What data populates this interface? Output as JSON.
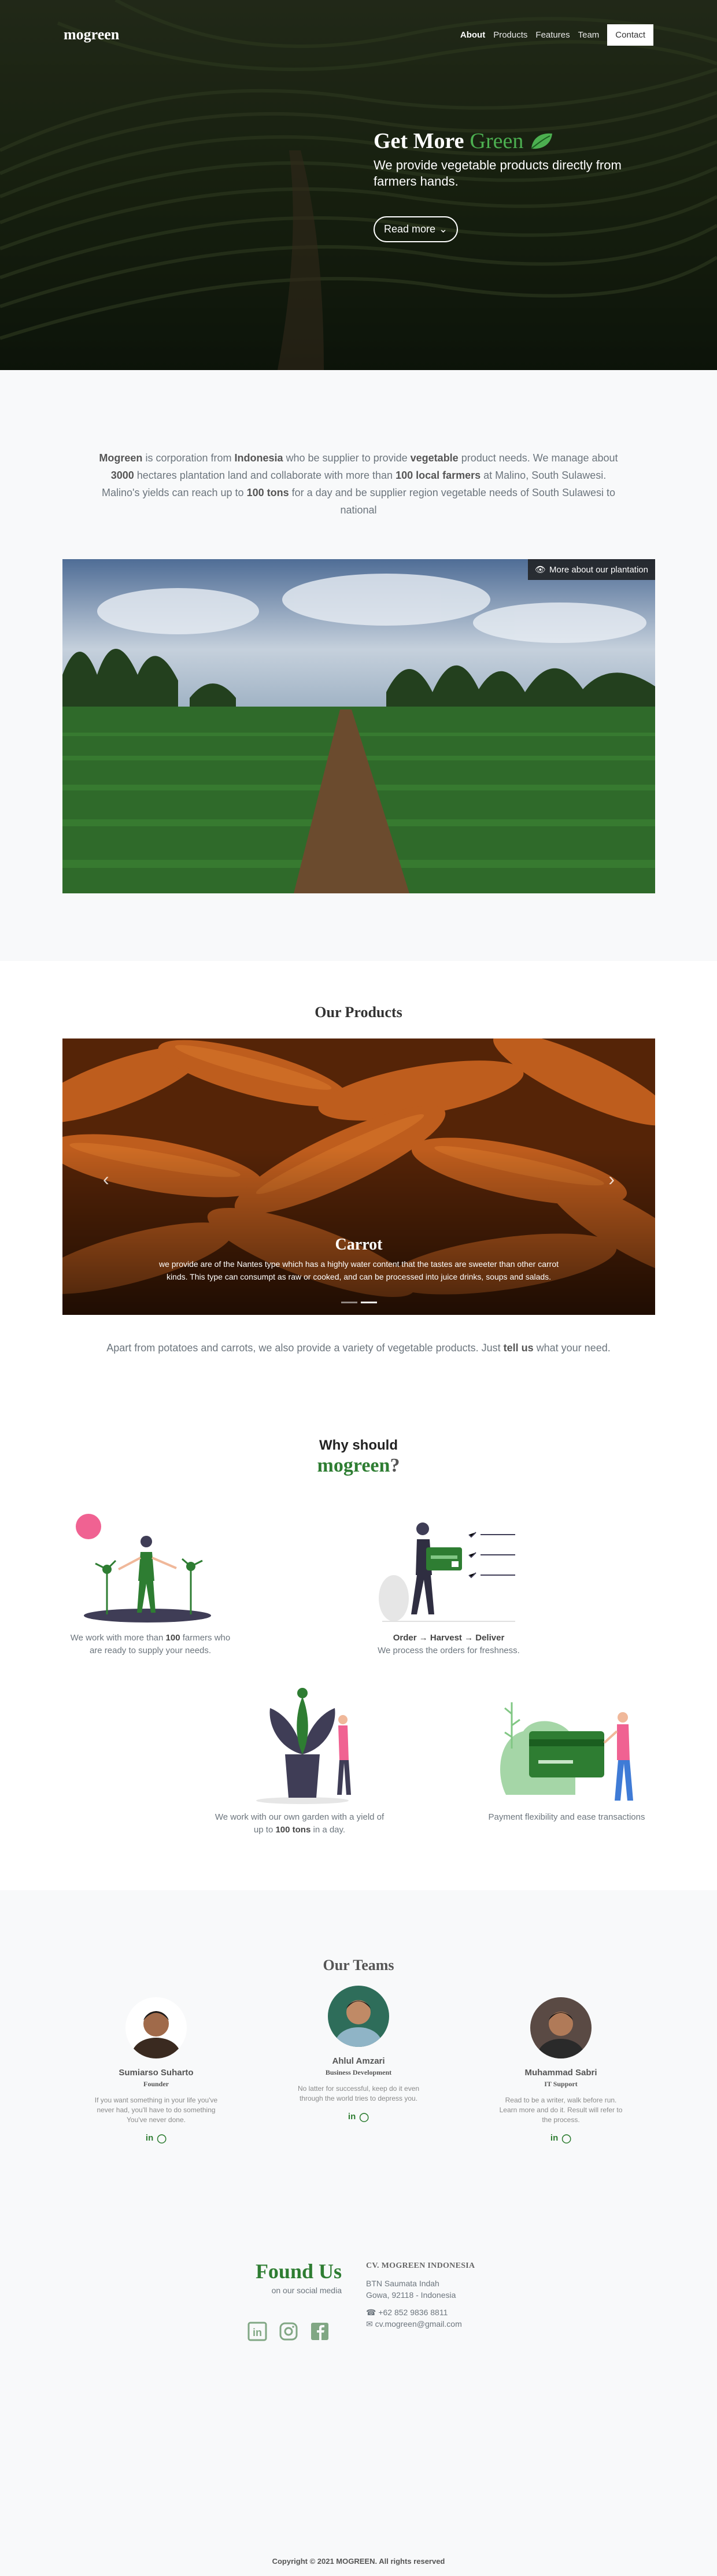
{
  "nav": {
    "logo": "mogreen",
    "links": [
      "About",
      "Products",
      "Features",
      "Team"
    ],
    "contact": "Contact"
  },
  "hero": {
    "title_prefix": "Get More",
    "title_green": "Green",
    "subtitle": "We provide vegetable products directly from farmers hands.",
    "button": "Read more"
  },
  "about": {
    "segments": [
      {
        "t": "Mogreen",
        "b": true
      },
      {
        "t": " is corporation from ",
        "b": false
      },
      {
        "t": "Indonesia",
        "b": true
      },
      {
        "t": " who be supplier to provide ",
        "b": false
      },
      {
        "t": "vegetable",
        "b": true
      },
      {
        "t": " product needs. We manage about ",
        "b": false
      },
      {
        "t": "3000",
        "b": true
      },
      {
        "t": " hectares plantation land and collaborate with more than ",
        "b": false
      },
      {
        "t": "100 local farmers",
        "b": true
      },
      {
        "t": " at Malino, South Sulawesi. Malino's yields can reach up to ",
        "b": false
      },
      {
        "t": "100 tons",
        "b": true
      },
      {
        "t": " for a day and be supplier region vegetable needs of South Sulawesi to national",
        "b": false
      }
    ],
    "plantation_button": "More about our plantation"
  },
  "products": {
    "title": "Our Products",
    "slide_title": "Carrot",
    "slide_text": "we provide are of the Nantes type which has a highly water content that the tastes are sweeter than other carrot kinds. This type can consumpt as raw or cooked, and can be processed into juice drinks, soups and salads.",
    "note_prefix": "Apart from potatoes and carrots, we also provide a variety of vegetable products. Just ",
    "note_bold": "tell us",
    "note_suffix": " what your need."
  },
  "why": {
    "title_line1": "Why should",
    "title_brand": "mogreen",
    "title_q": "?",
    "items": [
      {
        "pre": "We work with more than ",
        "bold": "100",
        "post": " farmers who are ready to supply your needs."
      },
      {
        "pre": "",
        "bold": "Order → Harvest → Deliver",
        "post": "We process the orders for freshness."
      },
      {
        "pre": "We work with our own garden with a yield of up to ",
        "bold": "100 tons",
        "post": " in a day."
      },
      {
        "pre": "Payment flexibility and ease transactions",
        "bold": "",
        "post": ""
      }
    ]
  },
  "teams": {
    "title": "Our Teams",
    "members": [
      {
        "name": "Sumiarso Suharto",
        "role": "Founder",
        "bio": "If you want something in your life you've never had, you'll have to do something You've never done."
      },
      {
        "name": "Ahlul Amzari",
        "role": "Business Development",
        "bio": "No latter for successful, keep do it even through the world tries to depress you."
      },
      {
        "name": "Muhammad Sabri",
        "role": "IT Support",
        "bio": "Read to be a writer, walk before run. Learn more and do it. Result will refer to the process."
      }
    ]
  },
  "footer": {
    "found_title": "Found Us",
    "found_sub": "on our social media",
    "company": "CV. MOGREEN INDONESIA",
    "address1": "BTN Saumata Indah",
    "address2": "Gowa, 92118 - Indonesia",
    "phone": "+62 852 9836 8811",
    "email": "cv.mogreen@gmail.com",
    "copyright": "Copyright © 2021 MOGREEN. All rights reserved"
  },
  "colors": {
    "brand_green": "#2e7d32",
    "accent_green": "#4caf50",
    "pink_dot": "#f06292"
  }
}
